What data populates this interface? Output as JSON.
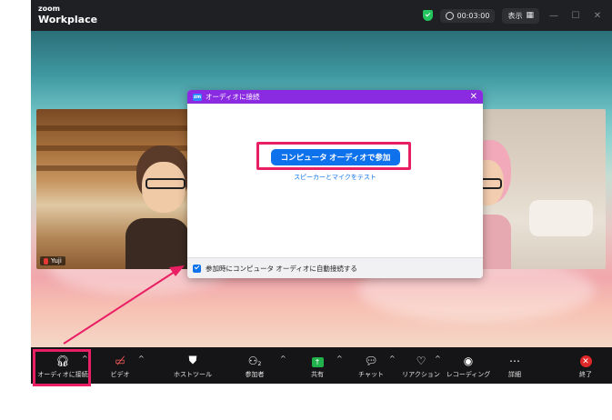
{
  "window": {
    "brand_small": "zoom",
    "brand_main": "Workplace",
    "timer": "00:03:00",
    "view_label": "表示"
  },
  "participants": {
    "left_name": "Yuji"
  },
  "dialog": {
    "title": "オーディオに接続",
    "join_button": "コンピュータ オーディオで参加",
    "test_link": "スピーカーとマイクをテスト",
    "auto_connect_label": "参加時にコンピュータ オーディオに自動接続する",
    "auto_connect_checked": true
  },
  "toolbar": {
    "audio": "オーディオに接続",
    "video": "ビデオ",
    "host_tools": "ホストツール",
    "participants": "参加者",
    "participants_count": "2",
    "share": "共有",
    "chat": "チャット",
    "reactions": "リアクション",
    "recording": "レコーディング",
    "more": "詳細",
    "end": "終了"
  },
  "colors": {
    "highlight": "#e91e63",
    "accent": "#0e72ed",
    "dialog_header": "#8a2be2",
    "security": "#23c55e",
    "end": "#e02828"
  }
}
